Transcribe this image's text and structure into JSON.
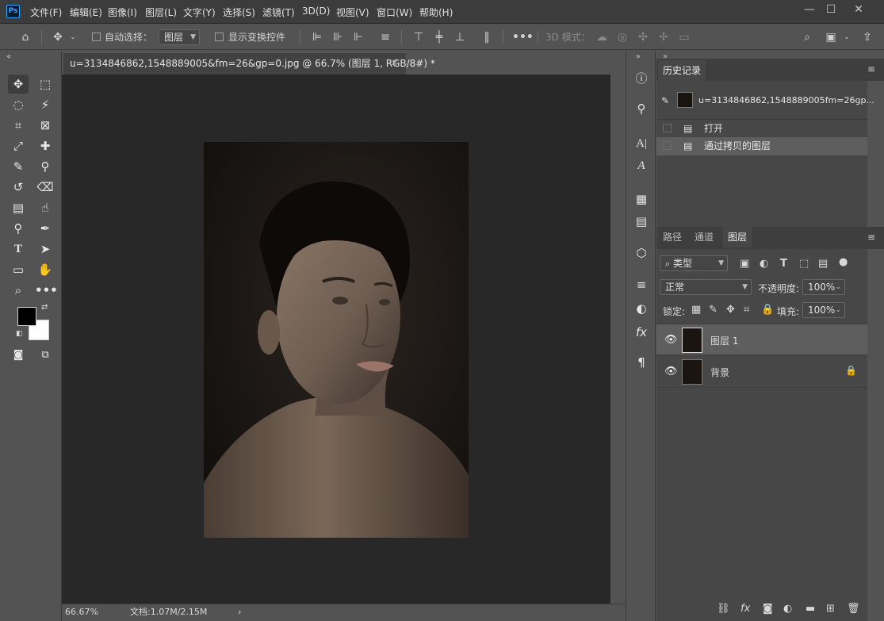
{
  "app": {
    "logo": "Ps",
    "accent": "#31a8ff"
  },
  "menu": [
    "文件(F)",
    "编辑(E)",
    "图像(I)",
    "图层(L)",
    "文字(Y)",
    "选择(S)",
    "滤镜(T)",
    "3D(D)",
    "视图(V)",
    "窗口(W)",
    "帮助(H)"
  ],
  "window_controls": {
    "minimize": "—",
    "maximize": "☐",
    "close": "✕"
  },
  "options": {
    "auto_select_label": "自动选择：",
    "auto_select_value": "图层",
    "show_transform_label": "显示变换控件",
    "mode_3d_label": "3D 模式："
  },
  "document": {
    "tab_title": "u=3134846862,1548889005&fm=26&gp=0.jpg @ 66.7% (图层 1, RGB/8#) *",
    "close": "✕"
  },
  "status": {
    "zoom": "66.67%",
    "doc_info": "文档:1.07M/2.15M",
    "arrow": "›"
  },
  "collapse": {
    "left": "«",
    "right": "»"
  },
  "history": {
    "tab_label": "历史记录",
    "snapshot_name": "u=3134846862,1548889005fm=26gp...",
    "items": [
      {
        "label": "打开",
        "active": false
      },
      {
        "label": "通过拷贝的图层",
        "active": true
      }
    ]
  },
  "layers_panel": {
    "tabs": [
      "路径",
      "通道",
      "图层"
    ],
    "active_tab": "图层",
    "filter_label": "类型",
    "blend_mode": "正常",
    "opacity_label": "不透明度:",
    "opacity_value": "100%",
    "lock_label": "锁定:",
    "fill_label": "填充:",
    "fill_value": "100%",
    "layers": [
      {
        "name": "图层 1",
        "selected": true,
        "locked": false
      },
      {
        "name": "背景",
        "selected": false,
        "locked": true
      }
    ]
  },
  "colors": {
    "foreground": "#000000",
    "background": "#ffffff"
  }
}
